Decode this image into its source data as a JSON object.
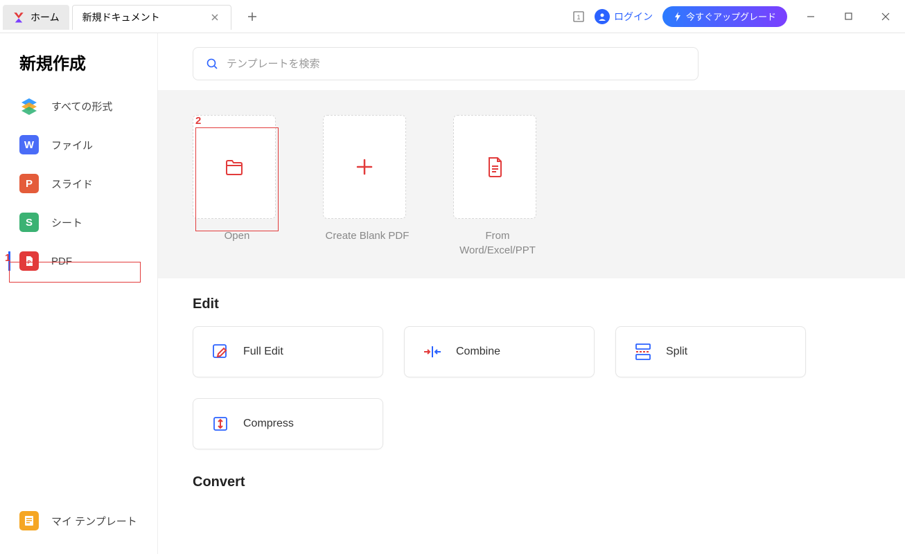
{
  "tabs": {
    "home": "ホーム",
    "doc": "新規ドキュメント"
  },
  "titlebar": {
    "login": "ログイン",
    "upgrade": "今すぐアップグレード",
    "count": "1"
  },
  "sidebar": {
    "title": "新規作成",
    "items": [
      {
        "label": "すべての形式"
      },
      {
        "label": "ファイル"
      },
      {
        "label": "スライド"
      },
      {
        "label": "シート"
      },
      {
        "label": "PDF"
      }
    ],
    "bottom": {
      "label": "マイ テンプレート"
    }
  },
  "search": {
    "placeholder": "テンプレートを検索"
  },
  "actions": [
    {
      "label": "Open"
    },
    {
      "label": "Create Blank PDF"
    },
    {
      "label": "From Word/Excel/PPT"
    }
  ],
  "sections": {
    "edit": {
      "title": "Edit",
      "tools": [
        {
          "label": "Full Edit"
        },
        {
          "label": "Combine"
        },
        {
          "label": "Split"
        },
        {
          "label": "Compress"
        }
      ]
    },
    "convert": {
      "title": "Convert"
    }
  },
  "annotations": {
    "a1": "1",
    "a2": "2"
  }
}
